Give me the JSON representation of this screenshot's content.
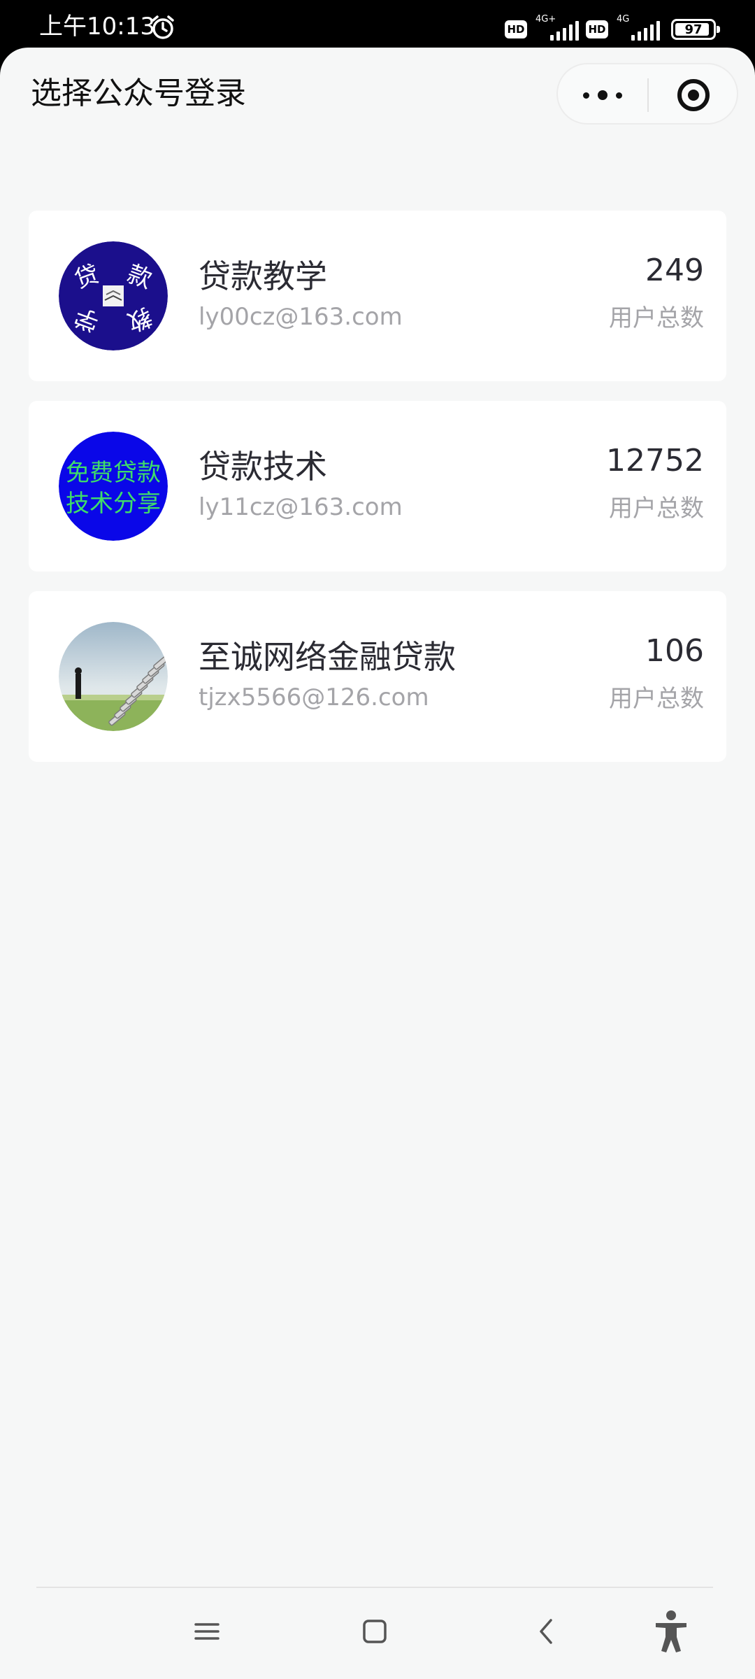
{
  "status_bar": {
    "time": "上午10:13",
    "hd_1": "HD",
    "network_1": "4G+",
    "hd_2": "HD",
    "network_2": "4G",
    "battery": "97",
    "icons": [
      "alarm-icon",
      "signal-icon",
      "battery-icon"
    ]
  },
  "header": {
    "title": "选择公众号登录",
    "more_icon": "more-dots-icon",
    "close_icon": "target-circle-icon"
  },
  "accounts": [
    {
      "name": "贷款教学",
      "email": "ly00cz@163.com",
      "count": "249",
      "count_label": "用户总数",
      "avatar": {
        "chars": [
          "贷",
          "款",
          "教",
          "学"
        ],
        "background": "#1b0f8c"
      }
    },
    {
      "name": "贷款技术",
      "email": "ly11cz@163.com",
      "count": "12752",
      "count_label": "用户总数",
      "avatar": {
        "line1": "免费贷款",
        "line2": "技术分享",
        "background": "#0a07e8",
        "text_color": "#3fdc6a"
      }
    },
    {
      "name": "至诚网络金融贷款",
      "email": "tjzx5566@126.com",
      "count": "106",
      "count_label": "用户总数",
      "avatar": {
        "description_icon": "staircase-coins-photo"
      }
    }
  ],
  "navigation": {
    "menu_icon": "menu-icon",
    "home_icon": "home-square-icon",
    "back_icon": "back-chevron-icon",
    "accessibility_icon": "accessibility-icon"
  }
}
